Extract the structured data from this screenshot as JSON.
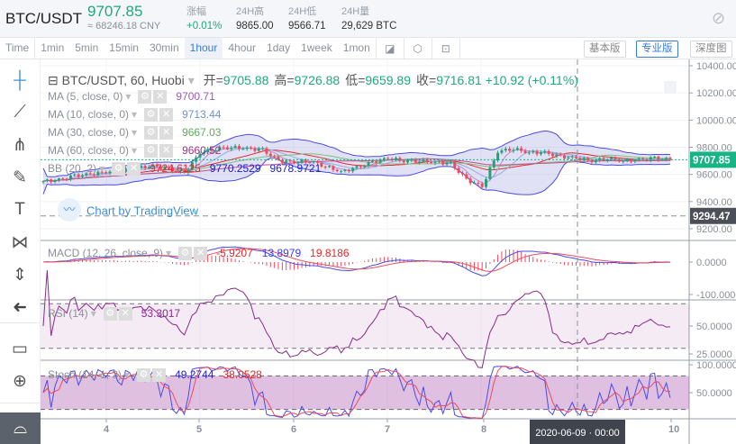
{
  "header": {
    "pair": "BTC/USDT",
    "last_price": "9707.85",
    "cny": "≈ 68246.18 CNY",
    "stats": [
      {
        "label": "涨幅",
        "value": "+0.01%",
        "color": "#21a87b"
      },
      {
        "label": "24H高",
        "value": "9865.00"
      },
      {
        "label": "24H低",
        "value": "9566.71"
      },
      {
        "label": "24H量",
        "value": "29,629 BTC"
      }
    ],
    "theme_icon": "moon-off-icon"
  },
  "toolbar": {
    "intervals": [
      "Time",
      "1min",
      "5min",
      "15min",
      "30min",
      "1hour",
      "4hour",
      "1day",
      "1week",
      "1mon"
    ],
    "active": "1hour",
    "icons": [
      "indicator-icon",
      "settings-icon",
      "screenshot-icon"
    ],
    "views": [
      "基本版",
      "专业版",
      "深度图"
    ],
    "active_view": "专业版"
  },
  "sidebar": {
    "tools": [
      "crosshair-icon",
      "trend-line-icon",
      "fork-icon",
      "brush-icon",
      "text-icon",
      "pattern-icon",
      "measure-levels-icon",
      "back-arrow-icon",
      "ruler-icon",
      "zoom-in-icon",
      "magnet-icon"
    ]
  },
  "legend": {
    "title": "BTC/USDT, 60, Huobi",
    "ohlc": [
      {
        "k": "开=",
        "v": "9705.88"
      },
      {
        "k": "高=",
        "v": "9726.88"
      },
      {
        "k": "低=",
        "v": "9659.89"
      },
      {
        "k": "收=",
        "v": "9716.81"
      }
    ],
    "change": "+10.92 (+0.11%)",
    "ma": [
      {
        "label": "MA (5, close, 0)",
        "value": "9700.71",
        "color": "#9a5cb4"
      },
      {
        "label": "MA (10, close, 0)",
        "value": "9713.44",
        "color": "#6b93cf"
      },
      {
        "label": "MA (30, close, 0)",
        "value": "9667.03",
        "color": "#5cab5f"
      },
      {
        "label": "MA (60, close, 0)",
        "value": "9660.52",
        "color": "#a0367a"
      }
    ],
    "bb": {
      "label": "BB (20, 2)",
      "values": [
        "9724.6125",
        "9770.2529",
        "9678.9721"
      ],
      "colors": [
        "#e8262a",
        "#1a1ae0",
        "#1a1ae0"
      ]
    },
    "macd": {
      "label": "MACD (12, 26, close, 9)",
      "values": [
        "-5.9207",
        "13.8979",
        "19.8186"
      ],
      "colors": [
        "#e8262a",
        "#3a3af0",
        "#e8262a"
      ]
    },
    "rsi": {
      "label": "RSI (14)",
      "value": "53.3017"
    },
    "stoch": {
      "label": "Stoch (14, 1, 3)",
      "values": [
        "49.2744",
        "38.0528"
      ]
    },
    "watermark": "Chart by TradingView"
  },
  "axes": {
    "price_ticks": [
      "10400.00",
      "10200.00",
      "10000.00",
      "9800.00",
      "9600.00",
      "9400.00",
      "9200.00"
    ],
    "last_label": "9707.85",
    "cross_label": "9294.47",
    "macd_ticks": [
      "0.0000",
      "-100.0000"
    ],
    "rsi_ticks": [
      "50.0000",
      "25.0000"
    ],
    "stoch_ticks": [
      "100.0000",
      "50.0000"
    ],
    "x_ticks": [
      "4",
      "5",
      "6",
      "7",
      "8",
      "10"
    ],
    "cross_time": "2020-06-09 · 00:00"
  },
  "colors": {
    "up": "#26a17b",
    "down": "#ef4b5a",
    "accent": "#3a7bd5",
    "last": "#17b584"
  },
  "chart_data": {
    "type": "candlestick",
    "interval": "1 hour",
    "close_every_4h": [
      9550,
      9560,
      9590,
      9600,
      9620,
      9630,
      9650,
      9660,
      9640,
      9610,
      9760,
      9790,
      9800,
      9790,
      9780,
      9700,
      9690,
      9700,
      9660,
      9620,
      9650,
      9690,
      9720,
      9700,
      9700,
      9690,
      9680,
      9560,
      9510,
      9770,
      9790,
      9760,
      9760,
      9730,
      9720,
      9700,
      9720,
      9700,
      9710,
      9720,
      9707.85
    ],
    "ylim": [
      9200,
      10400
    ]
  }
}
